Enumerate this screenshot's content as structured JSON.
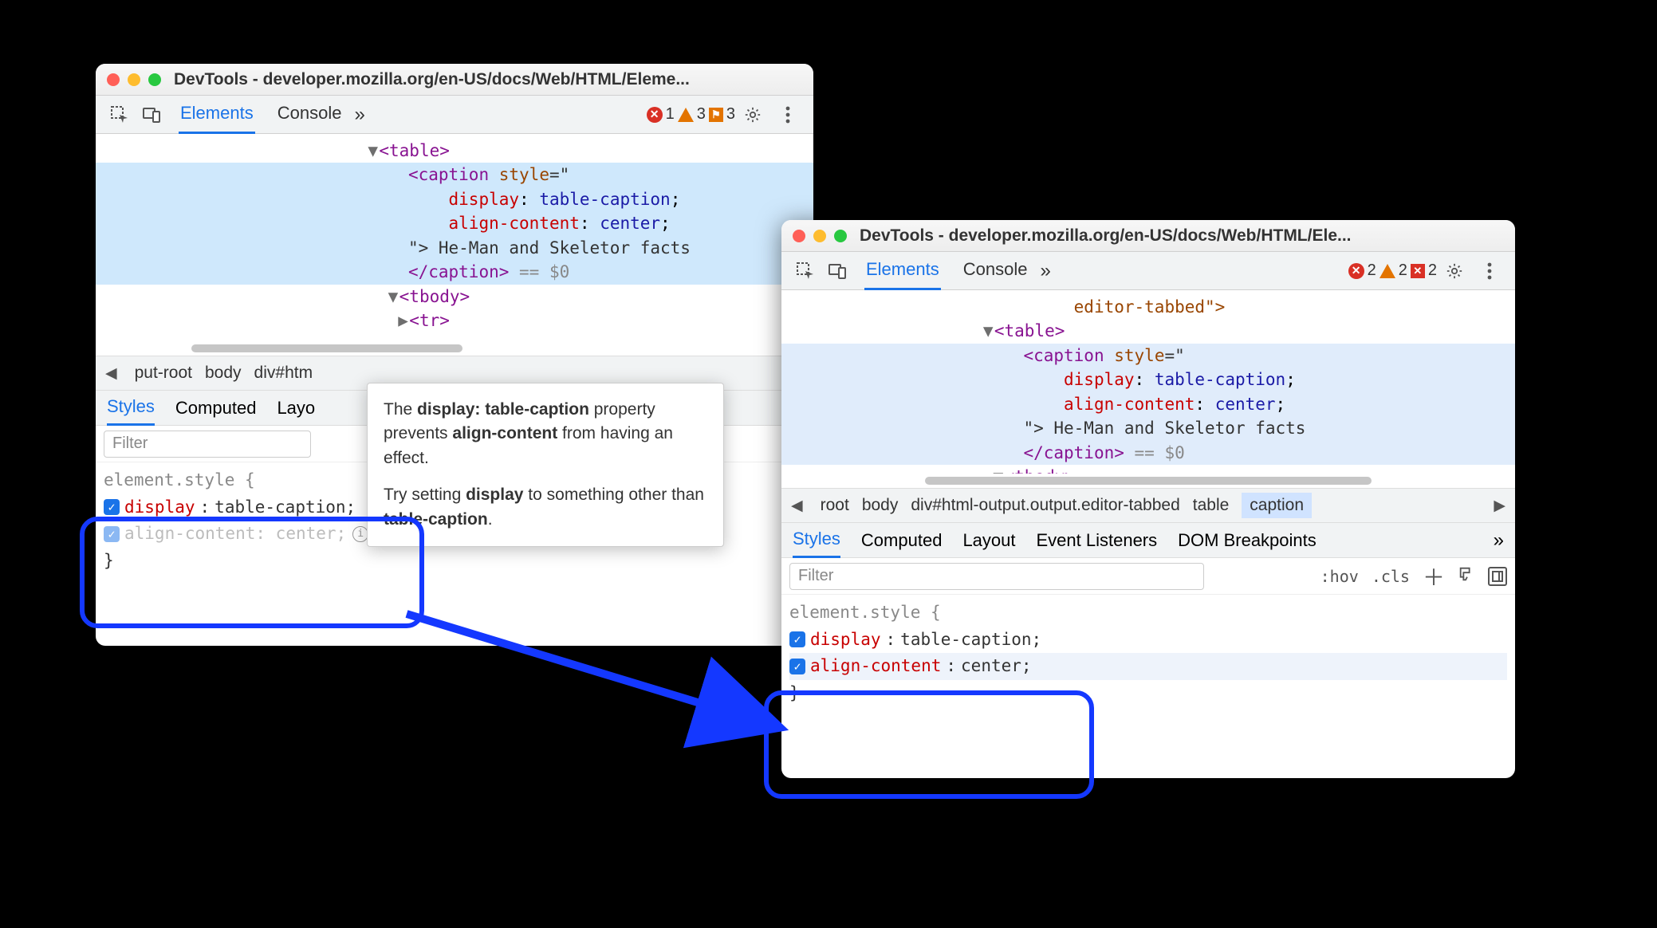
{
  "win1": {
    "title": "DevTools - developer.mozilla.org/en-US/docs/Web/HTML/Eleme...",
    "tabs": {
      "elements": "Elements",
      "console": "Console"
    },
    "badges": {
      "err": "1",
      "warn": "3",
      "flag": "3"
    },
    "dom": {
      "table": "<table>",
      "caption_open": "<caption",
      "style_attr": "style",
      "eq_open": "=\"",
      "css1_prop": "display",
      "css1_val": "table-caption",
      "css2_prop": "align-content",
      "css2_val": "center",
      "close_quote": "\">",
      "text": " He-Man and Skeletor facts",
      "caption_close": "</caption>",
      "sel": " == $0",
      "tbody": "<tbody>",
      "tr": "<tr>"
    },
    "crumbs": {
      "c1": "put-root",
      "c2": "body",
      "c3": "div#htm"
    },
    "subtabs": {
      "styles": "Styles",
      "computed": "Computed",
      "layout": "Layo"
    },
    "filter_placeholder": "Filter",
    "styles": {
      "selector": "element.style {",
      "l1_prop": "display",
      "l1_val": "table-caption;",
      "l2_prop": "align-content",
      "l2_val": "center;",
      "close": "}"
    },
    "tooltip": {
      "p1a": "The ",
      "p1b": "display: table-caption",
      "p1c": " property prevents ",
      "p1d": "align-content",
      "p1e": " from having an effect.",
      "p2a": "Try setting ",
      "p2b": "display",
      "p2c": " to something other than ",
      "p2d": "table-caption",
      "p2e": "."
    }
  },
  "win2": {
    "title": "DevTools - developer.mozilla.org/en-US/docs/Web/HTML/Ele...",
    "tabs": {
      "elements": "Elements",
      "console": "Console"
    },
    "badges": {
      "err": "2",
      "warn": "2",
      "flag": "2"
    },
    "dom": {
      "line0": "editor-tabbed\">",
      "table": "<table>",
      "caption_open": "<caption",
      "style_attr": "style",
      "eq_open": "=\"",
      "css1_prop": "display",
      "css1_val": "table-caption",
      "css2_prop": "align-content",
      "css2_val": "center",
      "close_quote": "\">",
      "text": " He-Man and Skeletor facts",
      "caption_close": "</caption>",
      "sel": " == $0",
      "tbody": "<tbody>"
    },
    "crumbs": {
      "c1": "root",
      "c2": "body",
      "c3": "div#html-output.output.editor-tabbed",
      "c4": "table",
      "c5": "caption"
    },
    "subtabs": {
      "styles": "Styles",
      "computed": "Computed",
      "layout": "Layout",
      "evt": "Event Listeners",
      "dombp": "DOM Breakpoints"
    },
    "filter_placeholder": "Filter",
    "filter_right": {
      "hov": ":hov",
      "cls": ".cls"
    },
    "styles": {
      "selector": "element.style {",
      "l1_prop": "display",
      "l1_val": "table-caption;",
      "l2_prop": "align-content",
      "l2_val": "center;",
      "close": "}"
    }
  }
}
